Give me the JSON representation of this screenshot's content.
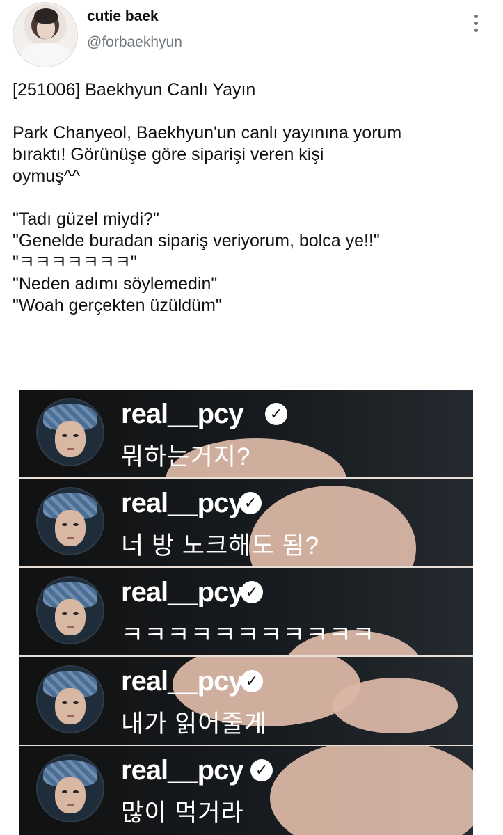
{
  "tweet": {
    "author": {
      "display_name": "cutie baek",
      "handle": "@forbaekhyun"
    },
    "more_icon": "more-vertical-icon",
    "text": {
      "line1": "[251006] Baekhyun Canlı Yayın",
      "line2": "Park Chanyeol, Baekhyun'un canlı yayınına yorum\nbıraktı! Görünüşe göre siparişi veren  kişi\noymuş^^",
      "quote1": "\"Tadı güzel miydi?\"",
      "quote2": "\"Genelde buradan sipariş veriyorum, bolca ye!!\"",
      "quote3": "\"ㅋㅋㅋㅋㅋㅋㅋ\"",
      "quote4": "\"Neden adımı söylemedin\"",
      "quote5": "\"Woah gerçekten üzüldüm\""
    }
  },
  "media": {
    "comments": [
      {
        "username": "real__pcy",
        "text": "뭐하는거지?"
      },
      {
        "username": "real__pcy",
        "text": "너 방 노크해도 됨?"
      },
      {
        "username": "real__pcy",
        "text": "ㅋㅋㅋㅋㅋㅋㅋㅋㅋㅋㅋ"
      },
      {
        "username": "real__pcy",
        "text": "내가 읽어줄게"
      },
      {
        "username": "real__pcy",
        "text": "많이 먹거라"
      }
    ],
    "verified_icon": "verified-badge-icon",
    "avatar_icon": "user-avatar-icon"
  }
}
